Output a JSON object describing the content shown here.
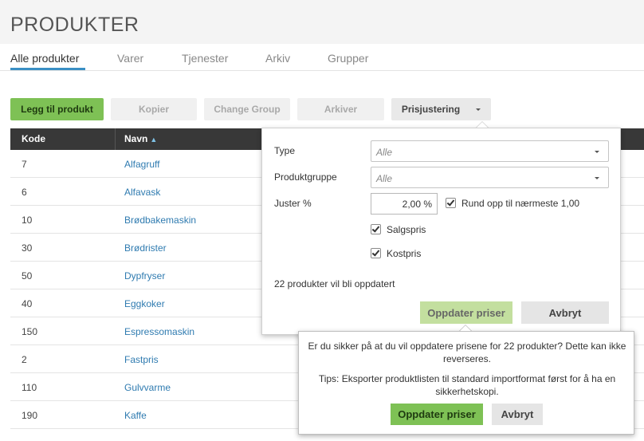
{
  "page": {
    "title": "PRODUKTER"
  },
  "tabs": [
    {
      "label": "Alle produkter",
      "active": true
    },
    {
      "label": "Varer"
    },
    {
      "label": "Tjenester"
    },
    {
      "label": "Arkiv"
    },
    {
      "label": "Grupper"
    }
  ],
  "toolbar": {
    "add_label": "Legg til produkt",
    "copy_label": "Kopier",
    "change_group_label": "Change Group",
    "archive_label": "Arkiver",
    "price_adjust_label": "Prisjustering"
  },
  "table": {
    "headers": {
      "code": "Kode",
      "name": "Navn",
      "sort_icon": "sort-ascending-icon"
    },
    "rows": [
      {
        "code": "7",
        "name": "Alfagruff"
      },
      {
        "code": "6",
        "name": "Alfavask"
      },
      {
        "code": "10",
        "name": "Brødbakemaskin"
      },
      {
        "code": "30",
        "name": "Brødrister"
      },
      {
        "code": "50",
        "name": "Dypfryser"
      },
      {
        "code": "40",
        "name": "Eggkoker"
      },
      {
        "code": "150",
        "name": "Espressomaskin"
      },
      {
        "code": "2",
        "name": "Fastpris"
      },
      {
        "code": "110",
        "name": "Gulvvarme"
      },
      {
        "code": "190",
        "name": "Kaffe"
      }
    ]
  },
  "price_popover": {
    "type_label": "Type",
    "type_value": "Alle",
    "group_label": "Produktgruppe",
    "group_value": "Alle",
    "adjust_label": "Juster %",
    "adjust_value": "2,00 %",
    "round_label": "Rund opp til nærmeste 1,00",
    "round_checked": true,
    "sales_label": "Salgspris",
    "sales_checked": true,
    "cost_label": "Kostpris",
    "cost_checked": true,
    "info_text": "22 produkter vil bli oppdatert",
    "update_label": "Oppdater priser",
    "cancel_label": "Avbryt"
  },
  "confirm": {
    "line1": "Er du sikker på at du vil oppdatere prisene for 22 produkter? Dette kan ikke reverseres.",
    "line2": "Tips: Eksporter produktlisten til standard importformat først for å ha en sikkerhetskopi.",
    "update_label": "Oppdater priser",
    "cancel_label": "Avbryt"
  },
  "colors": {
    "primary_green": "#7ec155",
    "link_blue": "#2f7bb0",
    "tab_accent": "#3a8fc4",
    "table_header": "#383838"
  }
}
